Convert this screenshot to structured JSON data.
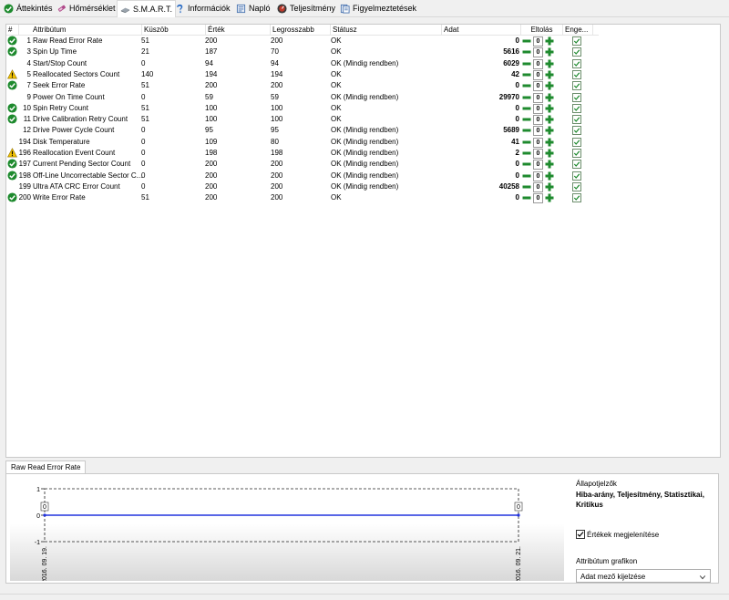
{
  "tabs": [
    {
      "label": "Áttekintés",
      "icon": "check-circle-icon"
    },
    {
      "label": "Hőmérséklet",
      "icon": "thermometer-icon"
    },
    {
      "label": "S.M.A.R.T.",
      "icon": "smart-drive-icon"
    },
    {
      "label": "Információk",
      "icon": "info-icon"
    },
    {
      "label": "Napló",
      "icon": "log-icon"
    },
    {
      "label": "Teljesítmény",
      "icon": "performance-icon"
    },
    {
      "label": "Figyelmeztetések",
      "icon": "alerts-icon"
    }
  ],
  "columns": {
    "num": "#",
    "attr": "Attribútum",
    "threshold": "Küszöb",
    "value": "Érték",
    "worst": "Legrosszabb",
    "status": "Státusz",
    "data": "Adat",
    "offset": "Eltolás",
    "enable": "Enge..."
  },
  "rows": [
    {
      "icon": "ok",
      "num": "1",
      "attr": "Raw Read Error Rate",
      "threshold": "51",
      "value": "200",
      "worst": "200",
      "status": "OK",
      "data": "0",
      "offset": "0"
    },
    {
      "icon": "ok",
      "num": "3",
      "attr": "Spin Up Time",
      "threshold": "21",
      "value": "187",
      "worst": "70",
      "status": "OK",
      "data": "5616",
      "offset": "0"
    },
    {
      "icon": "none",
      "num": "4",
      "attr": "Start/Stop Count",
      "threshold": "0",
      "value": "94",
      "worst": "94",
      "status": "OK (Mindig rendben)",
      "data": "6029",
      "offset": "0"
    },
    {
      "icon": "warn",
      "num": "5",
      "attr": "Reallocated Sectors Count",
      "threshold": "140",
      "value": "194",
      "worst": "194",
      "status": "OK",
      "data": "42",
      "offset": "0"
    },
    {
      "icon": "ok",
      "num": "7",
      "attr": "Seek Error Rate",
      "threshold": "51",
      "value": "200",
      "worst": "200",
      "status": "OK",
      "data": "0",
      "offset": "0"
    },
    {
      "icon": "none",
      "num": "9",
      "attr": "Power On Time Count",
      "threshold": "0",
      "value": "59",
      "worst": "59",
      "status": "OK (Mindig rendben)",
      "data": "29970",
      "offset": "0"
    },
    {
      "icon": "ok",
      "num": "10",
      "attr": "Spin Retry Count",
      "threshold": "51",
      "value": "100",
      "worst": "100",
      "status": "OK",
      "data": "0",
      "offset": "0"
    },
    {
      "icon": "ok",
      "num": "11",
      "attr": "Drive Calibration Retry Count",
      "threshold": "51",
      "value": "100",
      "worst": "100",
      "status": "OK",
      "data": "0",
      "offset": "0"
    },
    {
      "icon": "none",
      "num": "12",
      "attr": "Drive Power Cycle Count",
      "threshold": "0",
      "value": "95",
      "worst": "95",
      "status": "OK (Mindig rendben)",
      "data": "5689",
      "offset": "0"
    },
    {
      "icon": "none",
      "num": "194",
      "attr": "Disk Temperature",
      "threshold": "0",
      "value": "109",
      "worst": "80",
      "status": "OK (Mindig rendben)",
      "data": "41",
      "offset": "0"
    },
    {
      "icon": "warn",
      "num": "196",
      "attr": "Reallocation Event Count",
      "threshold": "0",
      "value": "198",
      "worst": "198",
      "status": "OK (Mindig rendben)",
      "data": "2",
      "offset": "0"
    },
    {
      "icon": "ok",
      "num": "197",
      "attr": "Current Pending Sector Count",
      "threshold": "0",
      "value": "200",
      "worst": "200",
      "status": "OK (Mindig rendben)",
      "data": "0",
      "offset": "0"
    },
    {
      "icon": "ok",
      "num": "198",
      "attr": "Off-Line Uncorrectable Sector C...",
      "threshold": "0",
      "value": "200",
      "worst": "200",
      "status": "OK (Mindig rendben)",
      "data": "0",
      "offset": "0"
    },
    {
      "icon": "none",
      "num": "199",
      "attr": "Ultra ATA CRC Error Count",
      "threshold": "0",
      "value": "200",
      "worst": "200",
      "status": "OK (Mindig rendben)",
      "data": "40258",
      "offset": "0"
    },
    {
      "icon": "ok",
      "num": "200",
      "attr": "Write Error Rate",
      "threshold": "51",
      "value": "200",
      "worst": "200",
      "status": "OK",
      "data": "0",
      "offset": "0"
    }
  ],
  "bottom": {
    "tab_label": "Raw Read Error Rate",
    "side_label": "Állapotjelzők",
    "side_value": "Hiba-arány, Teljesítmény, Statisztikai, Kritikus",
    "show_values_label": "Értékek megjelenítése",
    "attr_graph_label": "Attribútum grafikon",
    "select_value": "Adat mező kijelzése"
  },
  "chart_data": {
    "type": "line",
    "x": [
      "2016. 09. 19.",
      "2016. 09. 21."
    ],
    "series": [
      {
        "values": [
          0,
          0
        ]
      }
    ],
    "point_labels": [
      "0",
      "0"
    ],
    "yticks": [
      "1",
      "0",
      "-1"
    ],
    "ylim": [
      -1,
      1
    ],
    "line_color": "#2233dd"
  }
}
